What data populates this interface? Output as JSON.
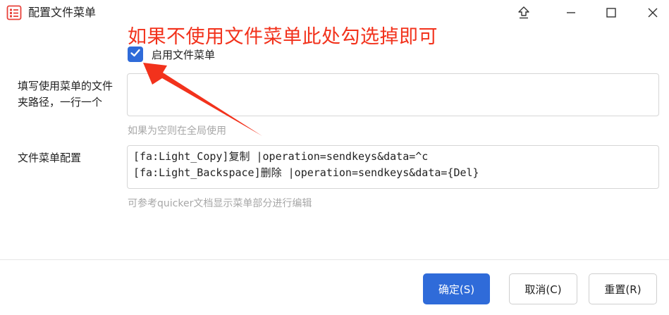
{
  "window": {
    "title": "配置文件菜单",
    "controls": [
      "pin-icon",
      "minimize-icon",
      "maximize-icon",
      "close-icon"
    ]
  },
  "annotation": {
    "text": "如果不使用文件菜单此处勾选掉即可",
    "color": "#f2321c"
  },
  "enable_checkbox": {
    "label": "启用文件菜单",
    "checked": true
  },
  "folder_paths": {
    "label": "填写使用菜单的文件夹路径，一行一个",
    "value": "",
    "hint": "如果为空则在全局使用"
  },
  "menu_config": {
    "label": "文件菜单配置",
    "lines": [
      "[fa:Light_Copy]复制 |operation=sendkeys&data=^c",
      "[fa:Light_Backspace]删除 |operation=sendkeys&data={Del}"
    ],
    "hint": "可参考quicker文档显示菜单部分进行编辑"
  },
  "buttons": {
    "ok": "确定(S)",
    "cancel": "取消(C)",
    "reset": "重置(R)"
  },
  "colors": {
    "accent": "#2f6bd9",
    "icon_red": "#e8413a",
    "hint_gray": "#a7a7a7"
  }
}
